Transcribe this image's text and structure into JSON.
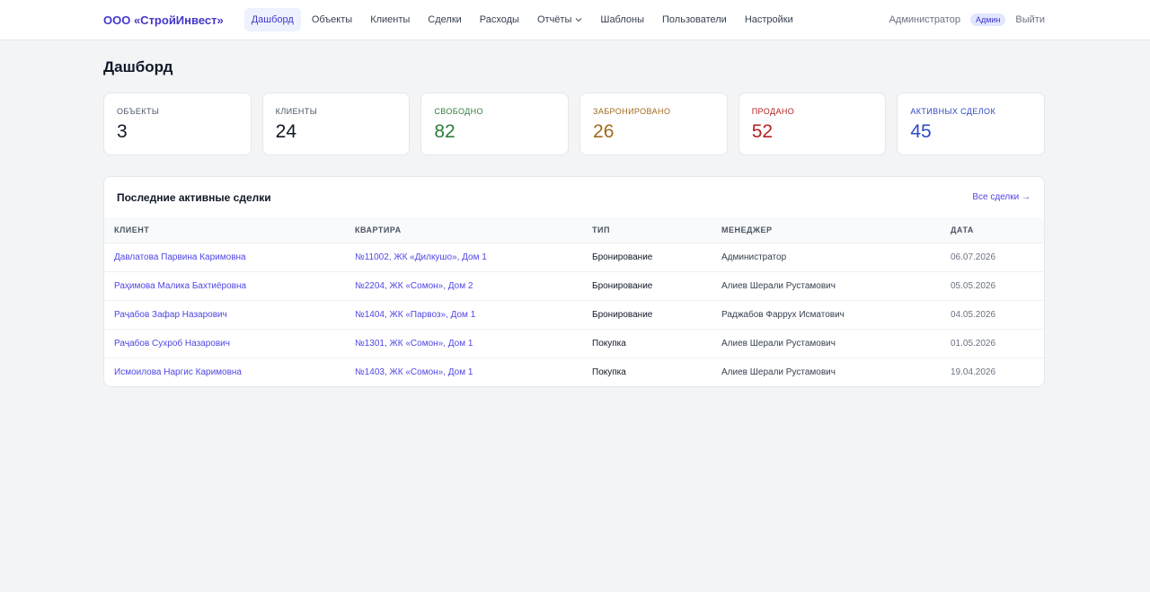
{
  "header": {
    "brand": "ООО «СтройИнвест»",
    "nav": [
      {
        "label": "Дашборд",
        "active": true
      },
      {
        "label": "Объекты"
      },
      {
        "label": "Клиенты"
      },
      {
        "label": "Сделки"
      },
      {
        "label": "Расходы"
      },
      {
        "label": "Отчёты",
        "dropdown": true
      },
      {
        "label": "Шаблоны"
      },
      {
        "label": "Пользователи"
      },
      {
        "label": "Настройки"
      }
    ],
    "user": "Администратор",
    "role": "Админ",
    "logout": "Выйти"
  },
  "page": {
    "title": "Дашборд"
  },
  "stats": [
    {
      "label": "Объекты",
      "value": "3",
      "color": "#111827",
      "label_color": "#4b5563"
    },
    {
      "label": "Клиенты",
      "value": "24",
      "color": "#111827",
      "label_color": "#4b5563"
    },
    {
      "label": "Свободно",
      "value": "82",
      "color": "#2f7d3a",
      "label_color": "#2f7d3a"
    },
    {
      "label": "Забронировано",
      "value": "26",
      "color": "#a16a1b",
      "label_color": "#a16a1b"
    },
    {
      "label": "Продано",
      "value": "52",
      "color": "#b42323",
      "label_color": "#b42323"
    },
    {
      "label": "Активных сделок",
      "value": "45",
      "color": "#2f49c7",
      "label_color": "#2f49c7"
    }
  ],
  "deals": {
    "title": "Последние активные сделки",
    "all_link": "Все сделки →",
    "columns": [
      "Клиент",
      "Квартира",
      "Тип",
      "Менеджер",
      "Дата"
    ],
    "rows": [
      [
        "Давлатова Парвина Каримовна",
        "№11002, ЖК «Дилкушо», Дом 1",
        "Бронирование",
        "Администратор",
        "06.07.2026"
      ],
      [
        "Раҳимова Малика Бахтиёровна",
        "№2204, ЖК «Сомон», Дом 2",
        "Бронирование",
        "Алиев Шерали Рустамович",
        "05.05.2026"
      ],
      [
        "Раҷабов Зафар Назарович",
        "№1404, ЖК «Парвоз», Дом 1",
        "Бронирование",
        "Раджабов Фаррух Исматович",
        "04.05.2026"
      ],
      [
        "Раҷабов Сухроб Назарович",
        "№1301, ЖК «Сомон», Дом 1",
        "Покупка",
        "Алиев Шерали Рустамович",
        "01.05.2026"
      ],
      [
        "Исмоилова Наргис Каримовна",
        "№1403, ЖК «Сомон», Дом 1",
        "Покупка",
        "Алиев Шерали Рустамович",
        "19.04.2026"
      ]
    ]
  }
}
